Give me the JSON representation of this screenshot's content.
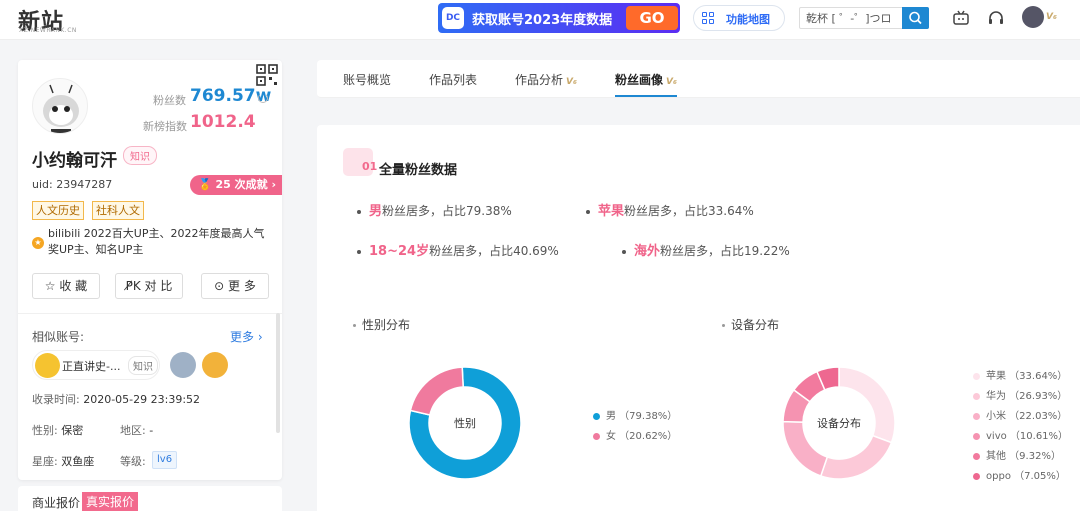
{
  "header": {
    "logo": "新站",
    "logo_sub": "XZ.NEWRANK.CN",
    "promo_icon": "DC",
    "promo_text": "获取账号2023年度数据",
    "promo_go": "GO",
    "feature_label": "功能地图",
    "search_value": "乾杯 [ ゜-゜]つロ",
    "vip_mark": "V₆"
  },
  "profile": {
    "fans_label": "粉丝数",
    "fans_value": "769.57w",
    "index_label": "新榜指数",
    "index_value": "1012.4",
    "name": "小约翰可汗",
    "name_tag": "知识",
    "uid": "uid: 23947287",
    "achievement": "25 次成就 ›",
    "categories": [
      "人文历史",
      "社科人文"
    ],
    "intro": "bilibili 2022百大UP主、2022年度最高人气奖UP主、知名UP主",
    "actions": [
      "☆ 收 藏",
      "P̸K 对 比",
      "⊙ 更 多"
    ],
    "similar_label": "相似账号:",
    "more_label": "更多 ›",
    "similar_name": "正直讲史-...",
    "similar_tag": "知识",
    "collect_time_label": "收录时间:",
    "collect_time": "2020-05-29 23:39:52",
    "gender_label": "性别:",
    "gender": "保密",
    "region_label": "地区:",
    "region": "-",
    "constellation_label": "星座:",
    "constellation": "双鱼座",
    "level_label": "等级:",
    "level": "lv6",
    "quote_label": "商业报价",
    "quote_tag": "真实报价"
  },
  "tabs": [
    {
      "label": "账号概览",
      "vip": ""
    },
    {
      "label": "作品列表",
      "vip": ""
    },
    {
      "label": "作品分析",
      "vip": "V₆"
    },
    {
      "label": "粉丝画像",
      "vip": "V₆"
    }
  ],
  "section": {
    "num": "01",
    "title": "全量粉丝数据",
    "facts": [
      {
        "hl": "男",
        "text": "粉丝居多，占比79.38%"
      },
      {
        "hl": "苹果",
        "text": "粉丝居多，占比33.64%"
      },
      {
        "hl": "18~24岁",
        "text": "粉丝居多，占比40.69%"
      },
      {
        "hl": "海外",
        "text": "粉丝居多，占比19.22%"
      }
    ]
  },
  "colors": {
    "male": "#0f9fd8",
    "female": "#f07a9e",
    "devices": [
      "#fde4ec",
      "#fcc9d8",
      "#f9b0c7",
      "#f593b1",
      "#f27a9e",
      "#ee6890"
    ]
  },
  "chart_data": [
    {
      "type": "pie",
      "title": "性别分布",
      "center_label": "性别",
      "categories": [
        "男",
        "女"
      ],
      "values": [
        79.38,
        20.62
      ],
      "legend": [
        "男 （79.38%）",
        "女 （20.62%）"
      ]
    },
    {
      "type": "pie",
      "title": "设备分布",
      "center_label": "设备分布",
      "categories": [
        "苹果",
        "华为",
        "小米",
        "vivo",
        "其他",
        "oppo"
      ],
      "values": [
        33.64,
        26.93,
        22.03,
        10.61,
        9.32,
        7.05
      ],
      "legend": [
        "苹果 （33.64%）",
        "华为 （26.93%）",
        "小米 （22.03%）",
        "vivo （10.61%）",
        "其他 （9.32%）",
        "oppo （7.05%）"
      ]
    }
  ]
}
